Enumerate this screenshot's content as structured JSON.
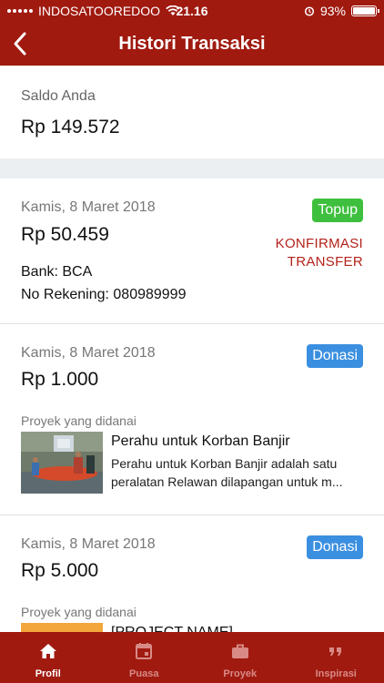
{
  "status_bar": {
    "carrier": "INDOSATOOREDOO",
    "time": "21.16",
    "battery": "93%",
    "battery_level": 0.93
  },
  "header": {
    "title": "Histori Transaksi",
    "back_icon": "chevron-left-icon"
  },
  "saldo": {
    "label": "Saldo Anda",
    "amount": "Rp 149.572"
  },
  "transactions": [
    {
      "date": "Kamis, 8 Maret 2018",
      "amount": "Rp 50.459",
      "type": "Topup",
      "action_line1": "KONFIRMASI",
      "action_line2": "TRANSFER",
      "bank": "Bank: BCA",
      "account": "No Rekening: 080989999"
    },
    {
      "date": "Kamis, 8 Maret 2018",
      "amount": "Rp 1.000",
      "type": "Donasi",
      "project_label": "Proyek yang didanai",
      "project_name": "Perahu untuk Korban Banjir",
      "project_desc": "Perahu untuk Korban Banjir adalah satu peralatan Relawan dilapangan untuk m..."
    },
    {
      "date": "Kamis, 8 Maret 2018",
      "amount": "Rp 5.000",
      "type": "Donasi",
      "project_label": "Proyek yang didanai",
      "project_name": "[PROJECT NAME]"
    }
  ],
  "tabs": [
    {
      "label": "Profil",
      "icon": "home-icon",
      "active": true
    },
    {
      "label": "Puasa",
      "icon": "calendar-icon",
      "active": false
    },
    {
      "label": "Proyek",
      "icon": "briefcase-icon",
      "active": false
    },
    {
      "label": "Inspirasi",
      "icon": "quote-icon",
      "active": false
    }
  ],
  "colors": {
    "brand": "#a01a10",
    "topup": "#3ec03e",
    "donasi": "#3b8fe0",
    "konfirmasi": "#b4211a"
  }
}
